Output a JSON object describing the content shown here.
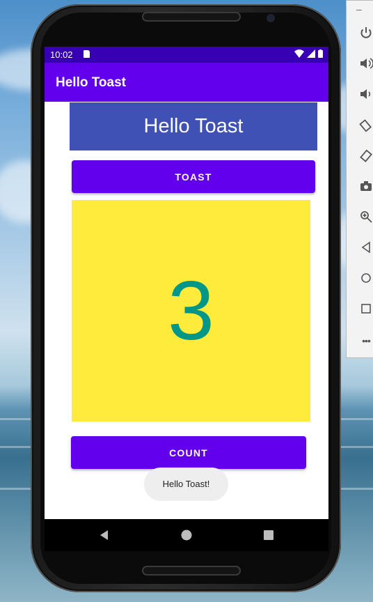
{
  "emulator_toolbar": {
    "minimize_label": "–",
    "buttons": [
      {
        "name": "power-icon"
      },
      {
        "name": "volume-up-icon"
      },
      {
        "name": "volume-down-icon"
      },
      {
        "name": "rotate-left-icon"
      },
      {
        "name": "rotate-right-icon"
      },
      {
        "name": "camera-icon"
      },
      {
        "name": "zoom-icon"
      },
      {
        "name": "back-icon"
      },
      {
        "name": "home-icon"
      },
      {
        "name": "overview-icon"
      },
      {
        "name": "more-icon"
      }
    ]
  },
  "status_bar": {
    "time": "10:02",
    "bg_color": "#3700b3"
  },
  "app_bar": {
    "title": "Hello Toast",
    "bg_color": "#6200ee"
  },
  "main": {
    "banner_text": "Hello Toast",
    "toast_button_label": "TOAST",
    "count_value": "3",
    "count_button_label": "COUNT",
    "toast_message": "Hello Toast!",
    "count_bg_color": "#ffeb3b",
    "count_text_color": "#009688"
  },
  "more_label": "•••"
}
